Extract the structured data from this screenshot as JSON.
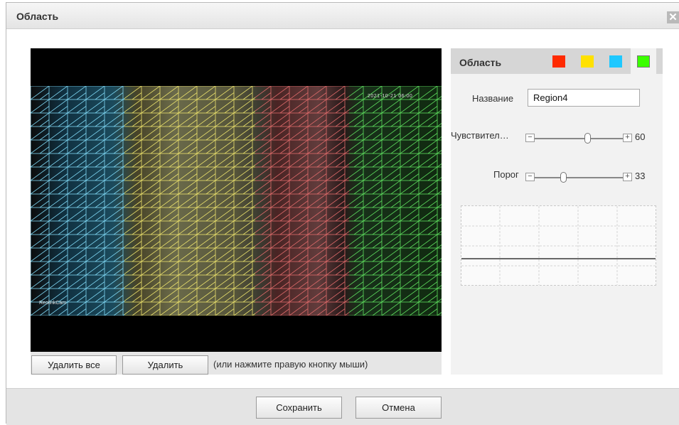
{
  "dialog": {
    "title": "Область",
    "close_label": "✕"
  },
  "video": {
    "timestamp": "2021-10-21 06:00",
    "channel_name": "ReolinkCam"
  },
  "toolbar": {
    "delete_all_label": "Удалить все",
    "delete_label": "Удалить",
    "hint": "(или нажмите правую кнопку мыши)"
  },
  "panel": {
    "title": "Область",
    "swatches": [
      {
        "name": "red",
        "color": "#ff2a00"
      },
      {
        "name": "yellow",
        "color": "#ffe100"
      },
      {
        "name": "cyan",
        "color": "#1ec8ff"
      },
      {
        "name": "green",
        "color": "#3bff00",
        "selected": true
      }
    ],
    "name_label": "Название",
    "name_value": "Region4",
    "sensitivity_label": "Чувствител…",
    "sensitivity_value": "60",
    "sensitivity_level": 0.6,
    "threshold_label": "Порог",
    "threshold_value": "33",
    "threshold_level": 0.33,
    "minus": "−",
    "plus": "+"
  },
  "footer": {
    "save_label": "Сохранить",
    "cancel_label": "Отмена"
  },
  "colors": {
    "accent_selected": "#3bff00",
    "title_bar": "#e9e9e9",
    "panel_bg": "#f2f2f2"
  }
}
